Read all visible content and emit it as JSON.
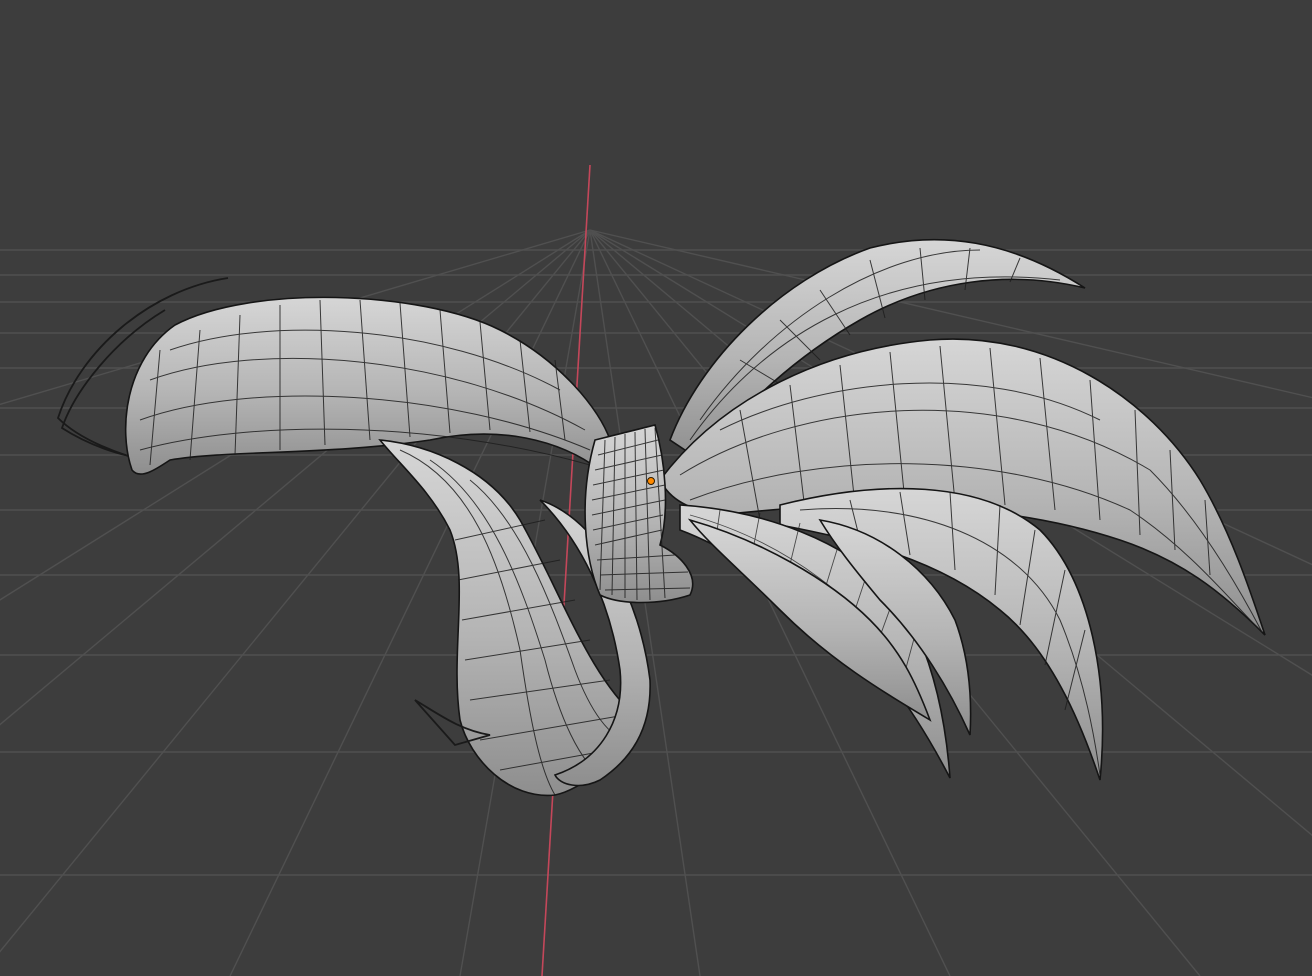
{
  "viewport": {
    "mode": "3D viewport",
    "shading": "solid",
    "overlays": "wireframe",
    "background": "#3d3d3d",
    "grid_color": "#505050",
    "axis_x_color": "#c4475a",
    "origin_color": "#ff8a00"
  },
  "object": {
    "type": "hair ponytail mesh",
    "icon": "mesh-icon"
  }
}
